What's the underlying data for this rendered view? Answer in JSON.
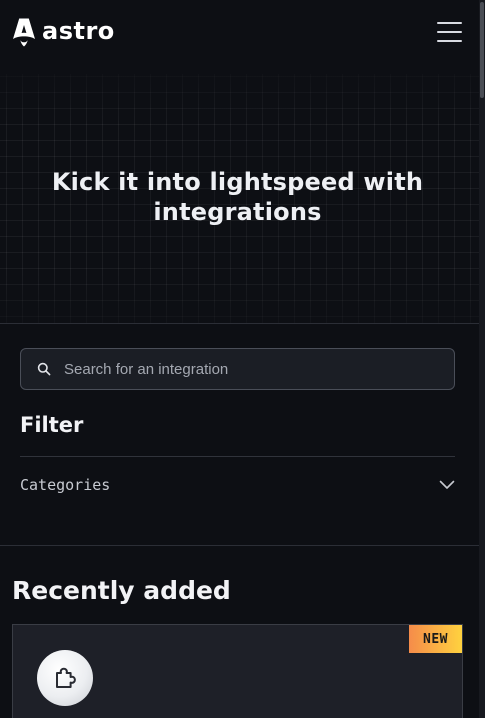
{
  "header": {
    "logo_text": "astro",
    "menu_icon": "hamburger-menu-icon"
  },
  "hero": {
    "title_line1": "Kick it into lightspeed with",
    "title_line2": "integrations"
  },
  "search": {
    "placeholder": "Search for an integration",
    "value": "",
    "icon": "search-icon"
  },
  "filter": {
    "heading": "Filter",
    "categories_label": "Categories",
    "categories_icon": "chevron-down-icon"
  },
  "recent": {
    "heading": "Recently added",
    "card": {
      "badge": "NEW",
      "icon": "puzzle-icon"
    }
  },
  "colors": {
    "background": "#0d0f14",
    "badge_gradient_start": "#f58c4a",
    "badge_gradient_end": "#ffd23f",
    "card_bg": "#1e2028"
  }
}
